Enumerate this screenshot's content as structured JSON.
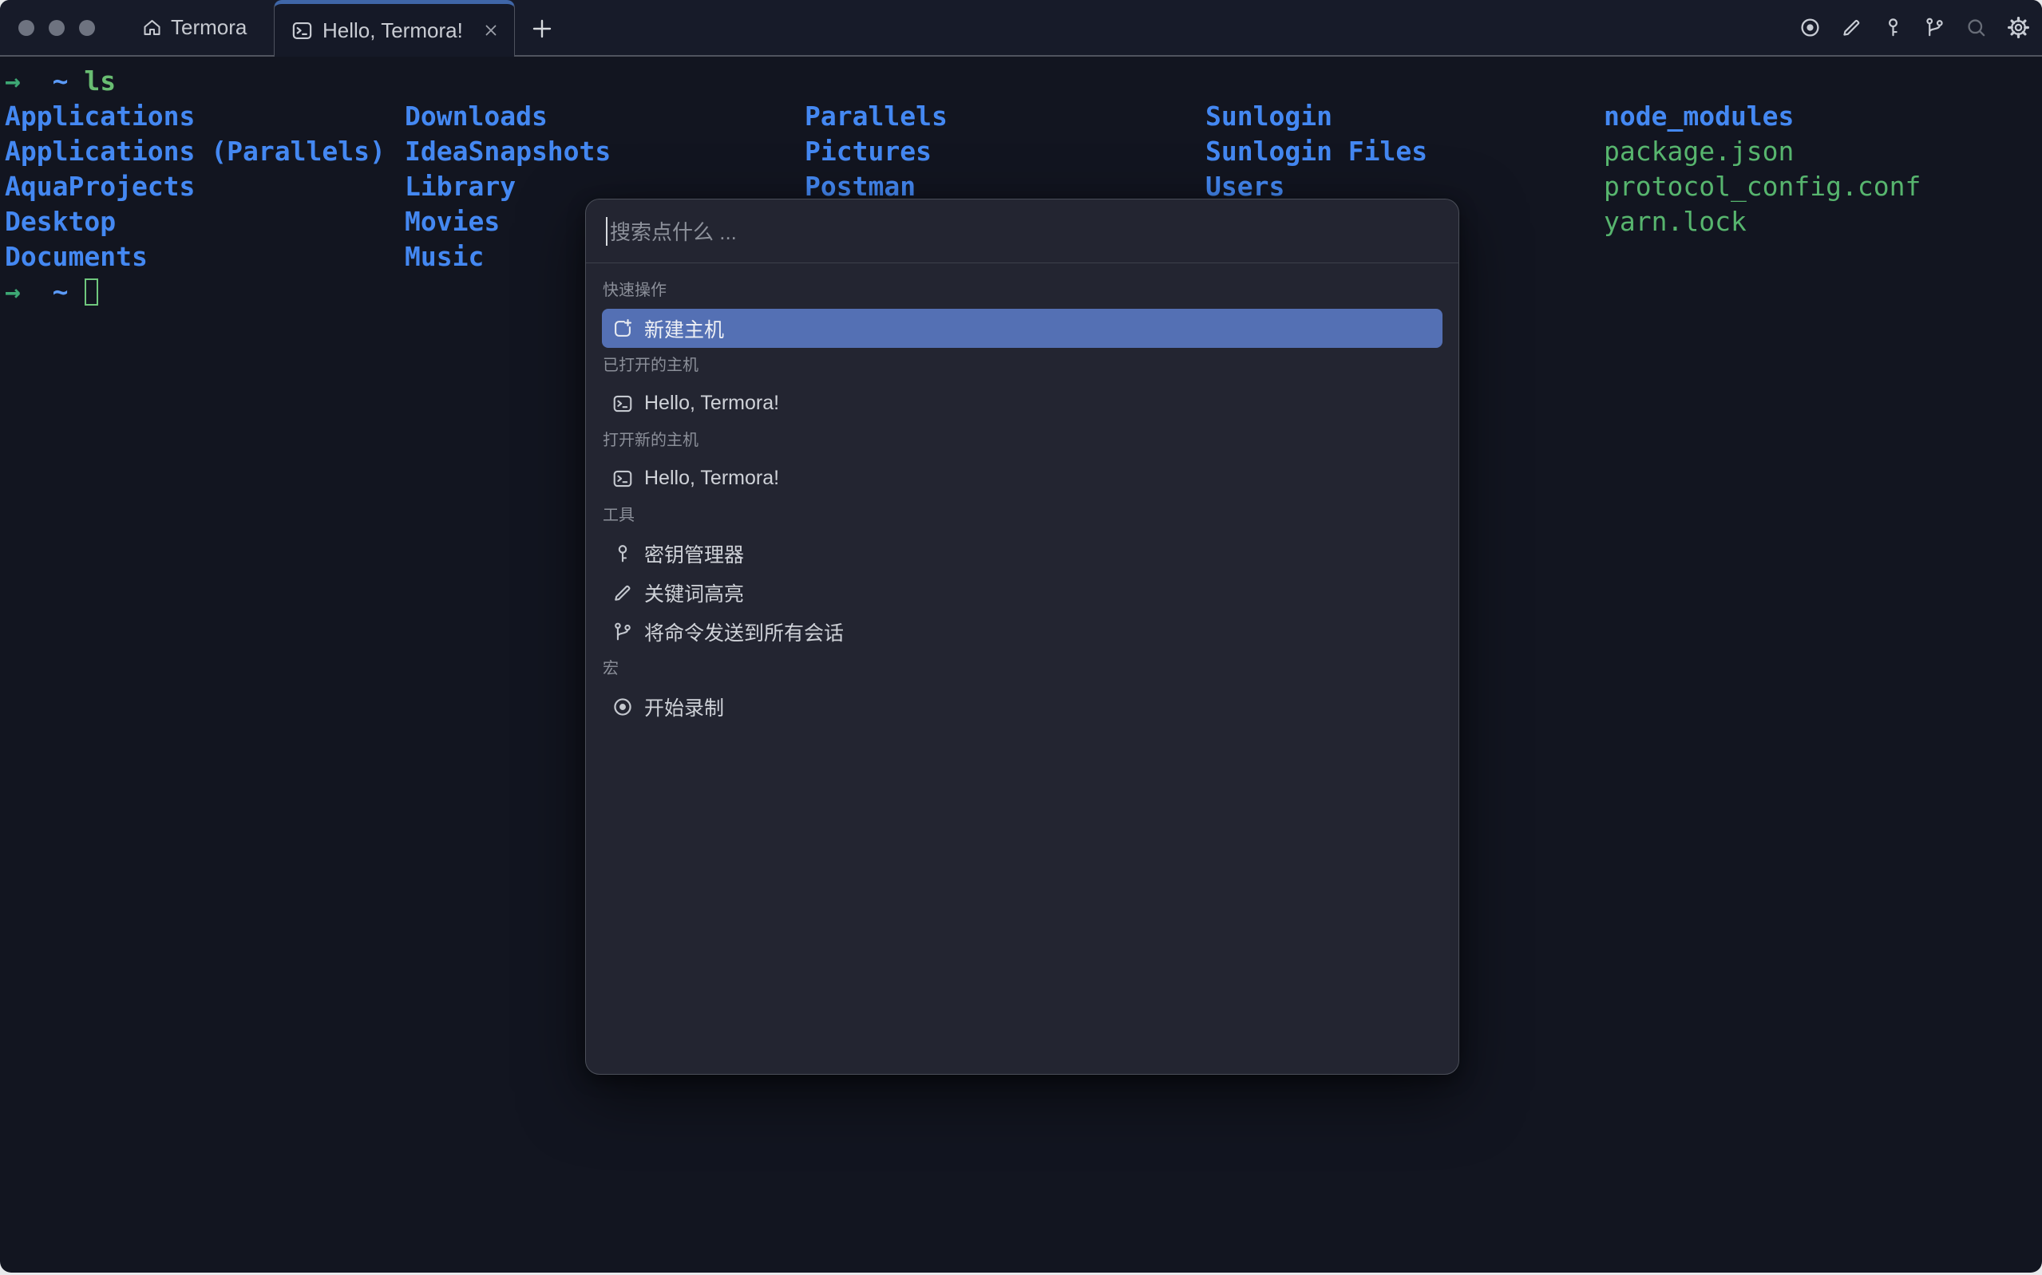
{
  "colors": {
    "terminal_bg": "#121520",
    "tabbar_bg": "#171b29",
    "tab_accent_blue": "#3f66a8",
    "palette_bg": "#232531",
    "selection_blue": "#5470b4",
    "dir_blue": "#4488f2",
    "file_green": "#57b56e",
    "prompt_green": "#3da874",
    "path_blue": "#5b9af8"
  },
  "tabbar": {
    "window_controls": [
      "dot",
      "dot",
      "dot"
    ],
    "home_label": "Termora",
    "tab_label": "Hello, Termora!",
    "new_tab_icon": "plus-icon",
    "toolbar_icons": [
      "record-icon",
      "pencil-icon",
      "key-icon",
      "branch-icon",
      "search-icon",
      "gear-icon"
    ]
  },
  "terminal": {
    "prompt_arrow": "→",
    "prompt_path": "~",
    "command": "ls",
    "columns": [
      {
        "entries": [
          {
            "name": "Applications",
            "type": "dir"
          },
          {
            "name": "Applications (Parallels)",
            "type": "dir"
          },
          {
            "name": "AquaProjects",
            "type": "dir"
          },
          {
            "name": "Desktop",
            "type": "dir"
          },
          {
            "name": "Documents",
            "type": "dir"
          }
        ]
      },
      {
        "entries": [
          {
            "name": "Downloads",
            "type": "dir"
          },
          {
            "name": "IdeaSnapshots",
            "type": "dir"
          },
          {
            "name": "Library",
            "type": "dir"
          },
          {
            "name": "Movies",
            "type": "dir"
          },
          {
            "name": "Music",
            "type": "dir"
          }
        ]
      },
      {
        "entries": [
          {
            "name": "Parallels",
            "type": "dir"
          },
          {
            "name": "Pictures",
            "type": "dir"
          },
          {
            "name": "Postman",
            "type": "dir"
          }
        ]
      },
      {
        "entries": [
          {
            "name": "Sunlogin",
            "type": "dir"
          },
          {
            "name": "Sunlogin Files",
            "type": "dir"
          },
          {
            "name": "Users",
            "type": "dir"
          }
        ]
      },
      {
        "entries": [
          {
            "name": "node_modules",
            "type": "dir"
          },
          {
            "name": "package.json",
            "type": "file"
          },
          {
            "name": "protocol_config.conf",
            "type": "file"
          },
          {
            "name": "yarn.lock",
            "type": "file"
          }
        ]
      }
    ]
  },
  "palette": {
    "search_placeholder": "搜索点什么 ...",
    "sections": [
      {
        "label": "快速操作",
        "items": [
          {
            "icon": "add-host-icon",
            "label": "新建主机",
            "selected": true
          }
        ]
      },
      {
        "label": "已打开的主机",
        "items": [
          {
            "icon": "terminal-icon",
            "label": "Hello, Termora!"
          }
        ]
      },
      {
        "label": "打开新的主机",
        "items": [
          {
            "icon": "terminal-icon",
            "label": "Hello, Termora!"
          }
        ]
      },
      {
        "label": "工具",
        "items": [
          {
            "icon": "key-icon",
            "label": "密钥管理器"
          },
          {
            "icon": "pencil-icon",
            "label": "关键词高亮"
          },
          {
            "icon": "branch-icon",
            "label": "将命令发送到所有会话"
          }
        ]
      },
      {
        "label": "宏",
        "items": [
          {
            "icon": "record-icon",
            "label": "开始录制"
          }
        ]
      }
    ]
  }
}
